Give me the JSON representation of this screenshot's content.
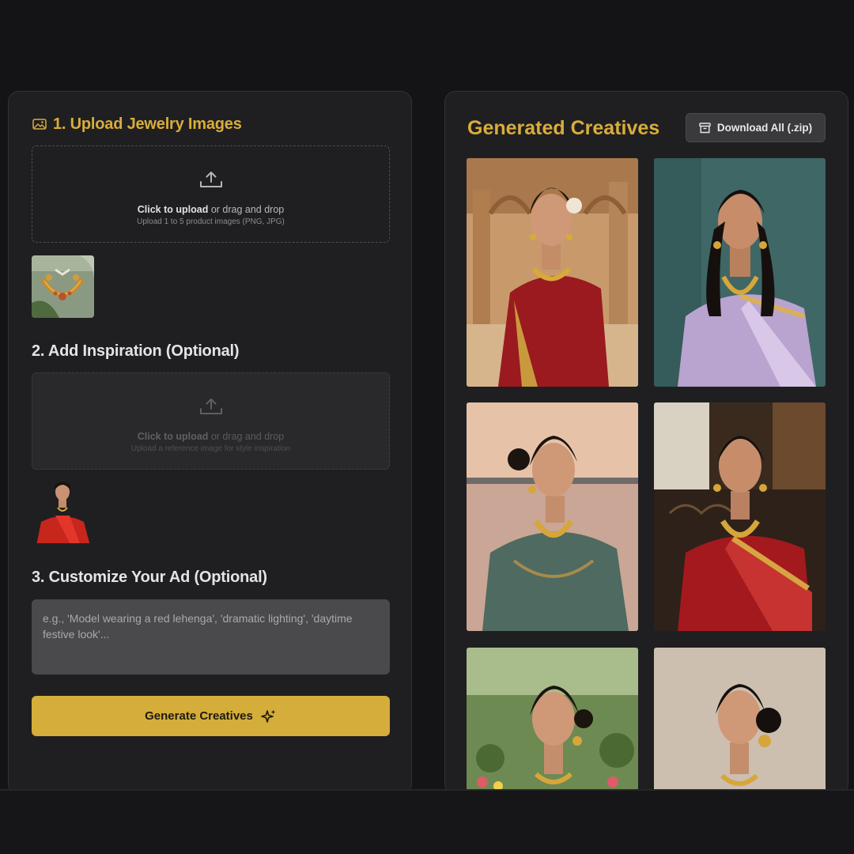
{
  "upload": {
    "title": "1. Upload Jewelry Images",
    "icon": "image-icon",
    "cta": "Click to upload",
    "cta_rest": " or drag and drop",
    "hint": "Upload 1 to 5 product images (PNG, JPG)"
  },
  "inspiration": {
    "title": "2. Add Inspiration (Optional)",
    "cta": "Click to upload",
    "cta_rest": " or drag and drop",
    "hint": "Upload a reference image for style inspiration"
  },
  "customize": {
    "title": "3. Customize Your Ad (Optional)",
    "placeholder": "e.g., 'Model wearing a red lehenga', 'dramatic lighting', 'daytime festive look'..."
  },
  "generate_label": "Generate Creatives",
  "results": {
    "title": "Generated Creatives",
    "download_label": "Download All (.zip)"
  },
  "colors": {
    "accent": "#d8ad3a",
    "panel": "#1f1f21",
    "background": "#141416"
  }
}
